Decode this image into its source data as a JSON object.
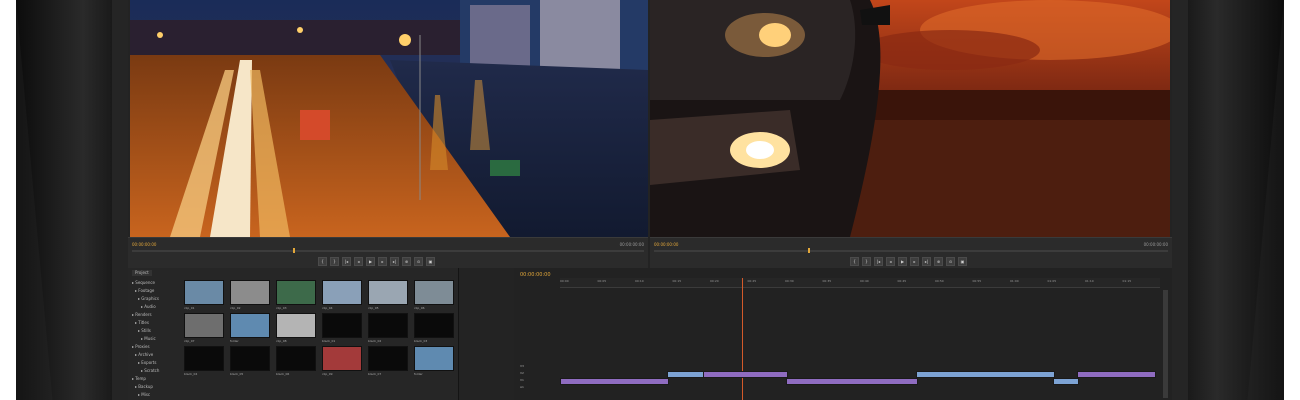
{
  "colors": {
    "accent_timecode": "#e2a73a",
    "clip_audio": "#8f6cc0",
    "clip_video": "#7da3d4",
    "playhead": "#d45a2a",
    "panel_bg": "#232323"
  },
  "source_monitor": {
    "timecode": "00:00:00:00",
    "duration": "00:00:00:00",
    "scene": "night-city-long-exposure"
  },
  "program_monitor": {
    "timecode": "00:00:00:00",
    "duration": "00:00:00:00",
    "scene": "car-headlight-sunset"
  },
  "transport_icons": [
    "mark-in-icon",
    "mark-out-icon",
    "go-to-in-icon",
    "step-back-icon",
    "play-icon",
    "step-forward-icon",
    "go-to-out-icon",
    "insert-icon",
    "overwrite-icon",
    "export-frame-icon"
  ],
  "project": {
    "tab_label": "Project",
    "tree_items": [
      "Sequence",
      "Footage",
      "Graphics",
      "Audio",
      "Renders",
      "Titles",
      "Stills",
      "Music",
      "Proxies",
      "Archive",
      "Exports",
      "Scratch",
      "Temp",
      "Backup",
      "Misc",
      "Assets"
    ],
    "thumbnails": [
      {
        "color": "#6a8aa6",
        "label": "clip_01"
      },
      {
        "color": "#8c8c8c",
        "label": "clip_02"
      },
      {
        "color": "#3d6a4a",
        "label": "clip_03"
      },
      {
        "color": "#8aa0b8",
        "label": "clip_04"
      },
      {
        "color": "#9aa6b2",
        "label": "clip_05"
      },
      {
        "color": "#7e8c96",
        "label": "clip_06"
      },
      {
        "color": "#6e6e6e",
        "label": "clip_07"
      },
      {
        "color": "#5f8ab0",
        "label": "folder"
      },
      {
        "color": "#b4b4b4",
        "label": "clip_08"
      },
      {
        "color": "#0a0a0a",
        "label": "black_01"
      },
      {
        "color": "#0a0a0a",
        "label": "black_02"
      },
      {
        "color": "#0a0a0a",
        "label": "black_03"
      },
      {
        "color": "#0a0a0a",
        "label": "black_04"
      },
      {
        "color": "#0a0a0a",
        "label": "black_05"
      },
      {
        "color": "#0a0a0a",
        "label": "black_06"
      },
      {
        "color": "#a33a3a",
        "label": "clip_09"
      },
      {
        "color": "#0a0a0a",
        "label": "black_07"
      },
      {
        "color": "#5f8ab0",
        "label": "folder"
      }
    ]
  },
  "timeline": {
    "timecode": "00:00:00:00",
    "ticks": [
      "00:00",
      "00:05",
      "00:10",
      "00:15",
      "00:20",
      "00:25",
      "00:30",
      "00:35",
      "00:40",
      "00:45",
      "00:50",
      "00:55",
      "01:00",
      "01:05",
      "01:10",
      "01:15"
    ],
    "tracks": [
      "V3",
      "V2",
      "V1",
      "A1"
    ],
    "clips": [
      {
        "track": 2,
        "start": 0.0,
        "end": 0.18,
        "kind": "audio",
        "label": ""
      },
      {
        "track": 1,
        "start": 0.18,
        "end": 0.24,
        "kind": "video",
        "label": ""
      },
      {
        "track": 1,
        "start": 0.24,
        "end": 0.38,
        "kind": "audio",
        "label": ""
      },
      {
        "track": 2,
        "start": 0.38,
        "end": 0.6,
        "kind": "audio",
        "label": ""
      },
      {
        "track": 1,
        "start": 0.6,
        "end": 0.83,
        "kind": "video",
        "label": ""
      },
      {
        "track": 2,
        "start": 0.83,
        "end": 0.87,
        "kind": "video",
        "label": ""
      },
      {
        "track": 1,
        "start": 0.87,
        "end": 1.0,
        "kind": "audio",
        "label": ""
      }
    ]
  }
}
